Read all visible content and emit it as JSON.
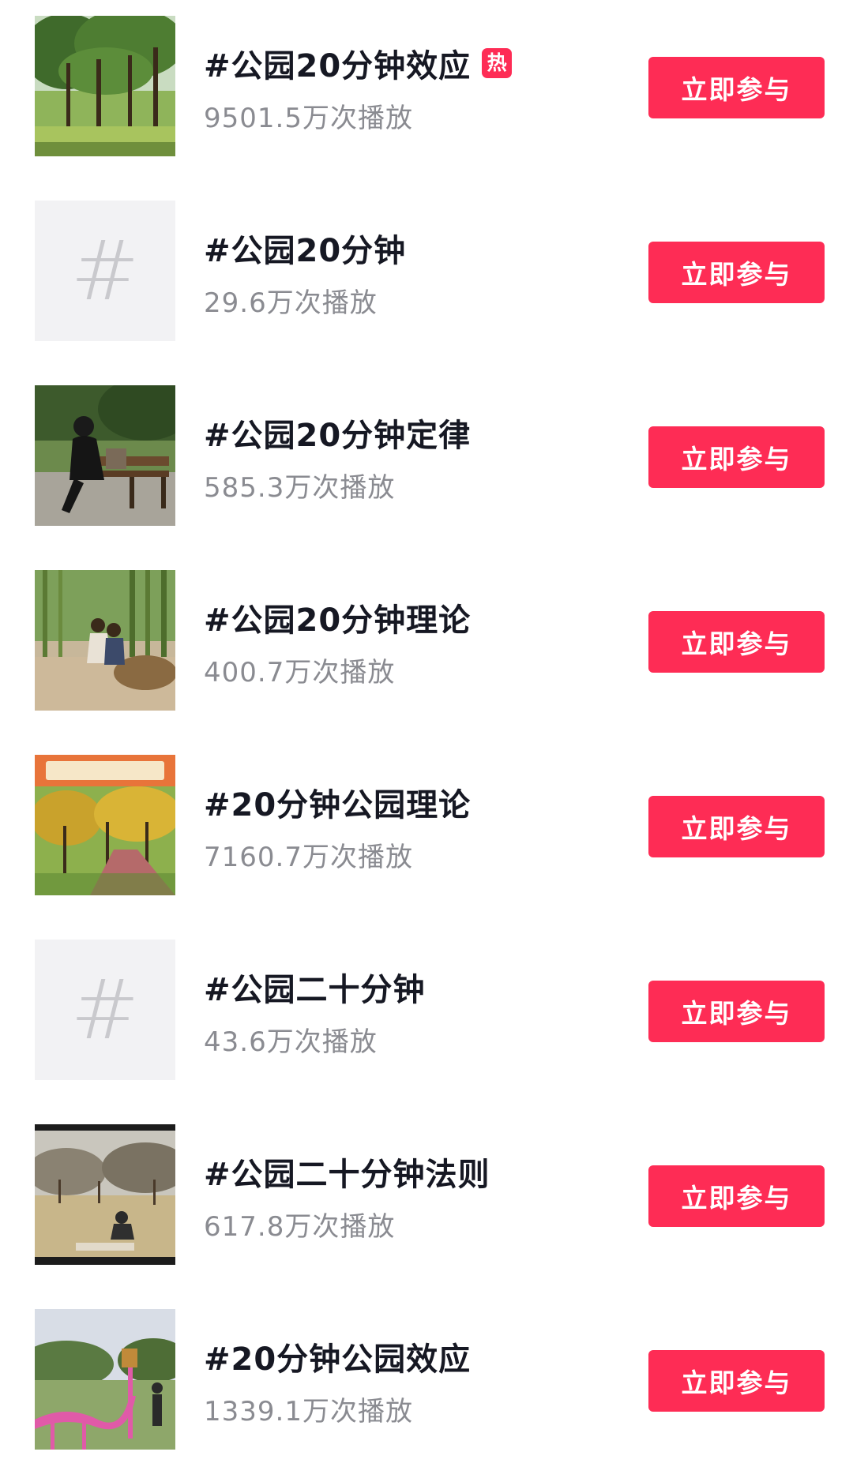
{
  "topics": [
    {
      "title": "#公园20分钟效应",
      "hot_badge": "热",
      "plays": "9501.5万次播放",
      "button_label": "立即参与",
      "thumbnail": "photo"
    },
    {
      "title": "#公园20分钟",
      "plays": "29.6万次播放",
      "button_label": "立即参与",
      "thumbnail": "hashtag-placeholder",
      "placeholder_glyph": "#"
    },
    {
      "title": "#公园20分钟定律",
      "plays": "585.3万次播放",
      "button_label": "立即参与",
      "thumbnail": "photo"
    },
    {
      "title": "#公园20分钟理论",
      "plays": "400.7万次播放",
      "button_label": "立即参与",
      "thumbnail": "photo"
    },
    {
      "title": "#20分钟公园理论",
      "plays": "7160.7万次播放",
      "button_label": "立即参与",
      "thumbnail": "photo"
    },
    {
      "title": "#公园二十分钟",
      "plays": "43.6万次播放",
      "button_label": "立即参与",
      "thumbnail": "hashtag-placeholder",
      "placeholder_glyph": "#"
    },
    {
      "title": "#公园二十分钟法则",
      "plays": "617.8万次播放",
      "button_label": "立即参与",
      "thumbnail": "photo"
    },
    {
      "title": "#20分钟公园效应",
      "plays": "1339.1万次播放",
      "button_label": "立即参与",
      "thumbnail": "photo"
    }
  ],
  "colors": {
    "accent": "#fe2c55",
    "title_text": "#161823",
    "secondary_text": "#8a8b91",
    "placeholder_bg": "#f2f2f4",
    "placeholder_glyph": "#c9c9cd"
  }
}
